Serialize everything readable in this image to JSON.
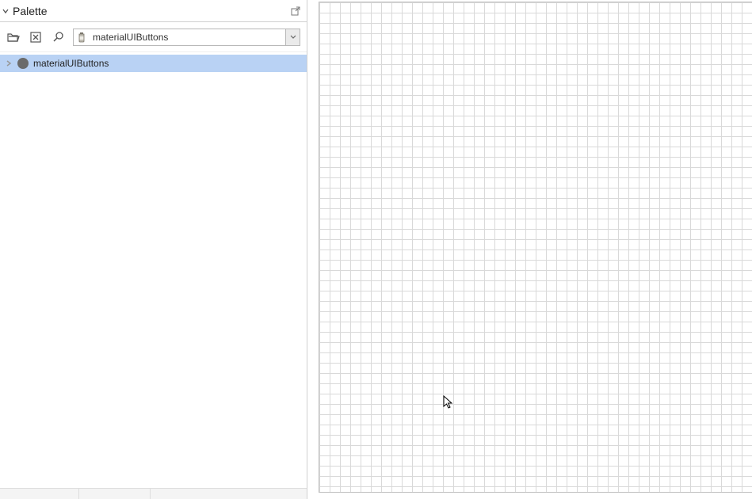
{
  "panel": {
    "title": "Palette"
  },
  "toolbar": {
    "filter_value": "materialUIButtons"
  },
  "tree": {
    "items": [
      {
        "label": "materialUIButtons"
      }
    ]
  }
}
